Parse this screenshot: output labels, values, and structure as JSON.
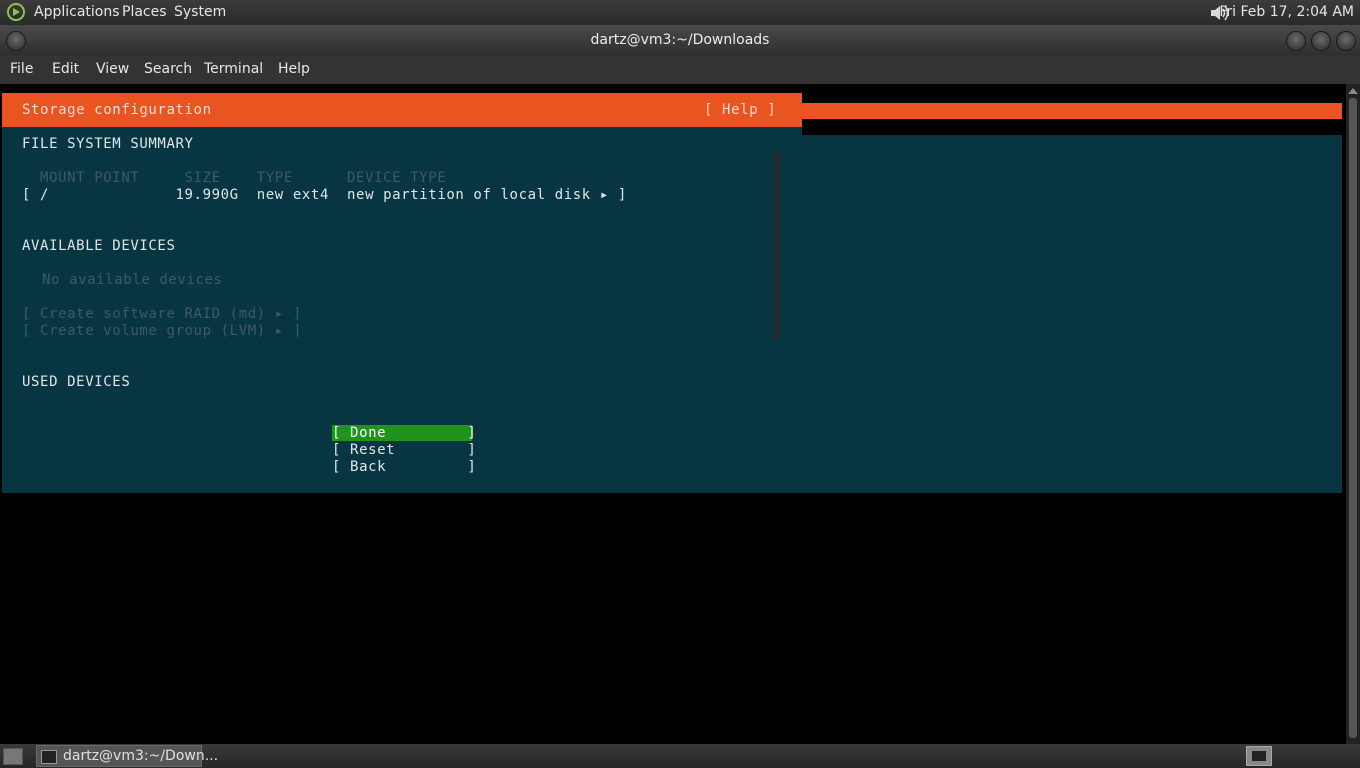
{
  "top_panel": {
    "menus": [
      "Applications",
      "Places",
      "System"
    ],
    "clock": "Fri Feb 17,  2:04 AM"
  },
  "window": {
    "title": "dartz@vm3:~/Downloads"
  },
  "menubar": [
    "File",
    "Edit",
    "View",
    "Search",
    "Terminal",
    "Help"
  ],
  "installer": {
    "header_title": "Storage configuration",
    "help_label": "[ Help ]",
    "fs_summary_heading": "FILE SYSTEM SUMMARY",
    "fs_columns": "  MOUNT POINT     SIZE    TYPE      DEVICE TYPE",
    "fs_row": "[ /              19.990G  new ext4  new partition of local disk ▸ ]",
    "available_heading": "AVAILABLE DEVICES",
    "no_devices": "No available devices",
    "create_raid": "[ Create software RAID (md) ▸ ]",
    "create_lvm": "[ Create volume group (LVM) ▸ ]",
    "used_heading": "USED DEVICES",
    "done_label": "[ Done         ]",
    "reset_label": "[ Reset        ]",
    "back_label": "[ Back         ]"
  },
  "taskbar": {
    "task_label": "dartz@vm3:~/Down..."
  },
  "colors": {
    "header_orange": "#e95420",
    "terminal_bg": "#073642",
    "done_green": "#20931f"
  }
}
